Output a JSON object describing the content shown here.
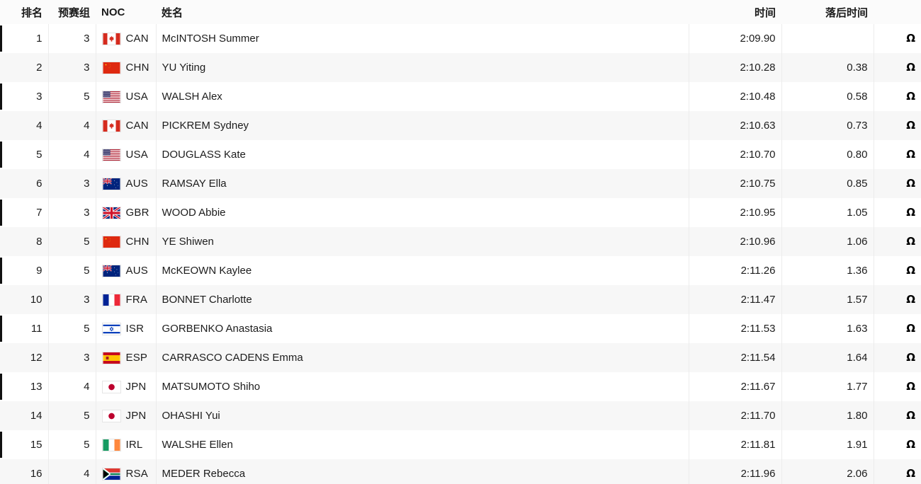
{
  "table": {
    "headers": {
      "rank": "排名",
      "heat": "预赛组",
      "noc": "NOC",
      "name": "姓名",
      "time": "时间",
      "gap": "落后时间",
      "omega": ""
    },
    "omega_symbol": "Ω",
    "rows": [
      {
        "rank": "1",
        "heat": "3",
        "noc": "CAN",
        "flag": "flag-can",
        "name": "McINTOSH Summer",
        "time": "2:09.90",
        "gap": "",
        "omega": "Ω"
      },
      {
        "rank": "2",
        "heat": "3",
        "noc": "CHN",
        "flag": "flag-chn",
        "name": "YU Yiting",
        "time": "2:10.28",
        "gap": "0.38",
        "omega": "Ω"
      },
      {
        "rank": "3",
        "heat": "5",
        "noc": "USA",
        "flag": "flag-usa",
        "name": "WALSH Alex",
        "time": "2:10.48",
        "gap": "0.58",
        "omega": "Ω"
      },
      {
        "rank": "4",
        "heat": "4",
        "noc": "CAN",
        "flag": "flag-can",
        "name": "PICKREM Sydney",
        "time": "2:10.63",
        "gap": "0.73",
        "omega": "Ω"
      },
      {
        "rank": "5",
        "heat": "4",
        "noc": "USA",
        "flag": "flag-usa",
        "name": "DOUGLASS Kate",
        "time": "2:10.70",
        "gap": "0.80",
        "omega": "Ω"
      },
      {
        "rank": "6",
        "heat": "3",
        "noc": "AUS",
        "flag": "flag-aus",
        "name": "RAMSAY Ella",
        "time": "2:10.75",
        "gap": "0.85",
        "omega": "Ω"
      },
      {
        "rank": "7",
        "heat": "3",
        "noc": "GBR",
        "flag": "flag-gbr",
        "name": "WOOD Abbie",
        "time": "2:10.95",
        "gap": "1.05",
        "omega": "Ω"
      },
      {
        "rank": "8",
        "heat": "5",
        "noc": "CHN",
        "flag": "flag-chn",
        "name": "YE Shiwen",
        "time": "2:10.96",
        "gap": "1.06",
        "omega": "Ω"
      },
      {
        "rank": "9",
        "heat": "5",
        "noc": "AUS",
        "flag": "flag-aus",
        "name": "McKEOWN Kaylee",
        "time": "2:11.26",
        "gap": "1.36",
        "omega": "Ω"
      },
      {
        "rank": "10",
        "heat": "3",
        "noc": "FRA",
        "flag": "flag-fra",
        "name": "BONNET Charlotte",
        "time": "2:11.47",
        "gap": "1.57",
        "omega": "Ω"
      },
      {
        "rank": "11",
        "heat": "5",
        "noc": "ISR",
        "flag": "flag-isr",
        "name": "GORBENKO Anastasia",
        "time": "2:11.53",
        "gap": "1.63",
        "omega": "Ω"
      },
      {
        "rank": "12",
        "heat": "3",
        "noc": "ESP",
        "flag": "flag-esp",
        "name": "CARRASCO CADENS Emma",
        "time": "2:11.54",
        "gap": "1.64",
        "omega": "Ω"
      },
      {
        "rank": "13",
        "heat": "4",
        "noc": "JPN",
        "flag": "flag-jpn",
        "name": "MATSUMOTO Shiho",
        "time": "2:11.67",
        "gap": "1.77",
        "omega": "Ω"
      },
      {
        "rank": "14",
        "heat": "5",
        "noc": "JPN",
        "flag": "flag-jpn",
        "name": "OHASHI Yui",
        "time": "2:11.70",
        "gap": "1.80",
        "omega": "Ω"
      },
      {
        "rank": "15",
        "heat": "5",
        "noc": "IRL",
        "flag": "flag-irl",
        "name": "WALSHE Ellen",
        "time": "2:11.81",
        "gap": "1.91",
        "omega": "Ω"
      },
      {
        "rank": "16",
        "heat": "4",
        "noc": "RSA",
        "flag": "flag-rsa",
        "name": "MEDER Rebecca",
        "time": "2:11.96",
        "gap": "2.06",
        "omega": "Ω"
      }
    ]
  },
  "colors": {
    "row_odd_bg": "#ffffff",
    "row_even_bg": "#f7f7f7",
    "header_bg": "#fbfbfb",
    "text": "#1c1c1c",
    "rank_marker": "#111111",
    "cell_border": "#ececec"
  }
}
